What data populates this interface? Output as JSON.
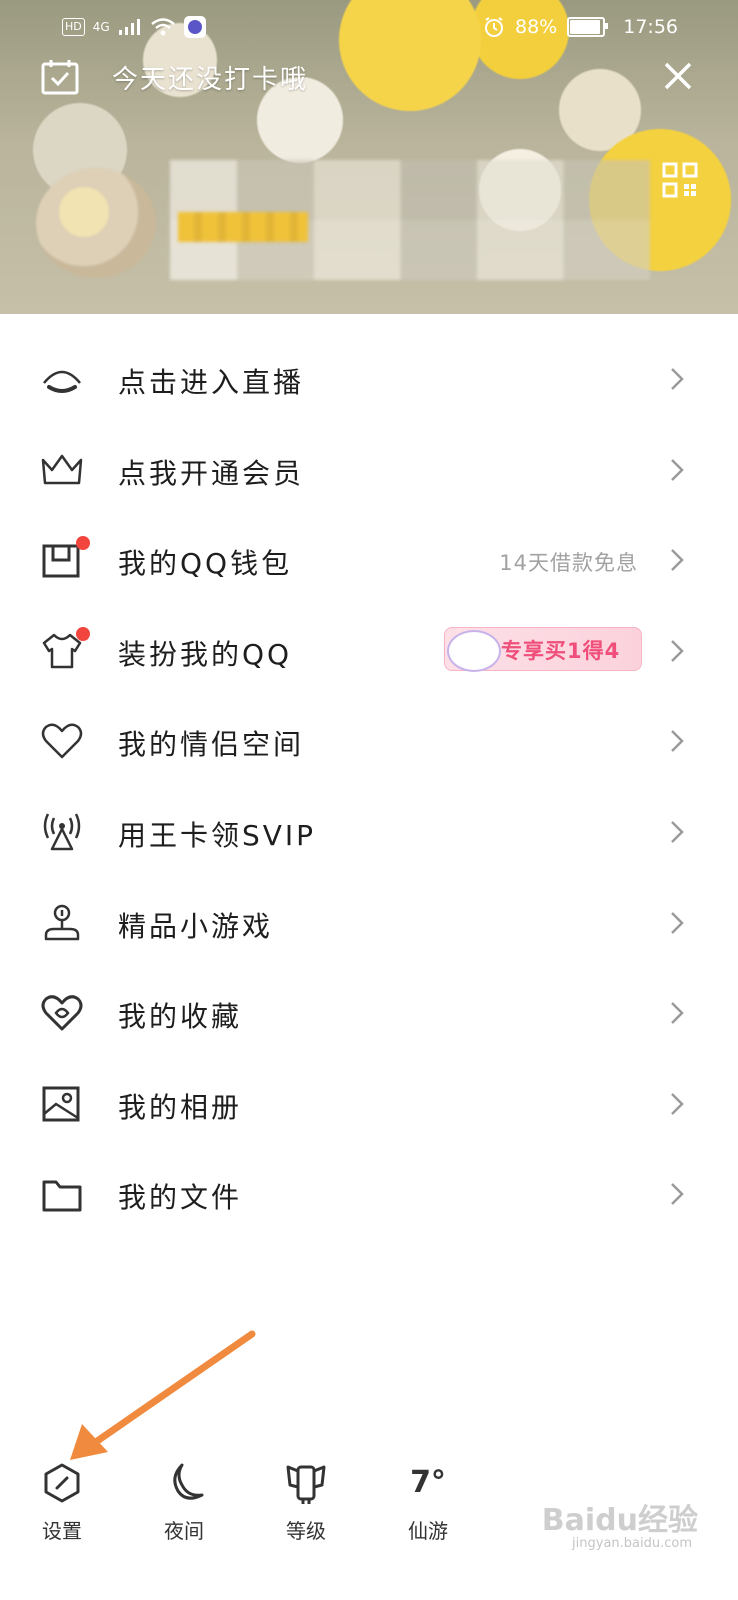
{
  "status_bar": {
    "hd": "HD",
    "network": "4G",
    "battery_text": "88%",
    "battery_level": 0.88,
    "time": "17:56"
  },
  "header": {
    "checkin_text": "今天还没打卡哦"
  },
  "menu": {
    "items": [
      {
        "label": "点击进入直播",
        "icon": "live-icon"
      },
      {
        "label": "点我开通会员",
        "icon": "crown-icon"
      },
      {
        "label": "我的QQ钱包",
        "icon": "wallet-icon",
        "value": "14天借款免息",
        "badge": "red-dot"
      },
      {
        "label": "装扮我的QQ",
        "icon": "tshirt-icon",
        "promo": "专享买1得4",
        "badge": "red-dot"
      },
      {
        "label": "我的情侣空间",
        "icon": "heart-icon"
      },
      {
        "label": "用王卡领SVIP",
        "icon": "signal-tower-icon"
      },
      {
        "label": "精品小游戏",
        "icon": "game-icon"
      },
      {
        "label": "我的收藏",
        "icon": "favorite-icon"
      },
      {
        "label": "我的相册",
        "icon": "album-icon"
      },
      {
        "label": "我的文件",
        "icon": "folder-icon"
      }
    ]
  },
  "bottom_bar": {
    "items": [
      {
        "label": "设置",
        "icon": "settings-icon"
      },
      {
        "label": "夜间",
        "icon": "moon-icon"
      },
      {
        "label": "等级",
        "icon": "level-icon"
      },
      {
        "label": "仙游",
        "icon": "weather-icon",
        "temperature": "7°"
      }
    ]
  },
  "watermark": {
    "text": "Baidu经验",
    "sub": "jingyan.baidu.com"
  },
  "colors": {
    "red_dot": "#f2453d",
    "promo_text": "#ef4f7a",
    "annotation_arrow": "#f08a3e"
  }
}
